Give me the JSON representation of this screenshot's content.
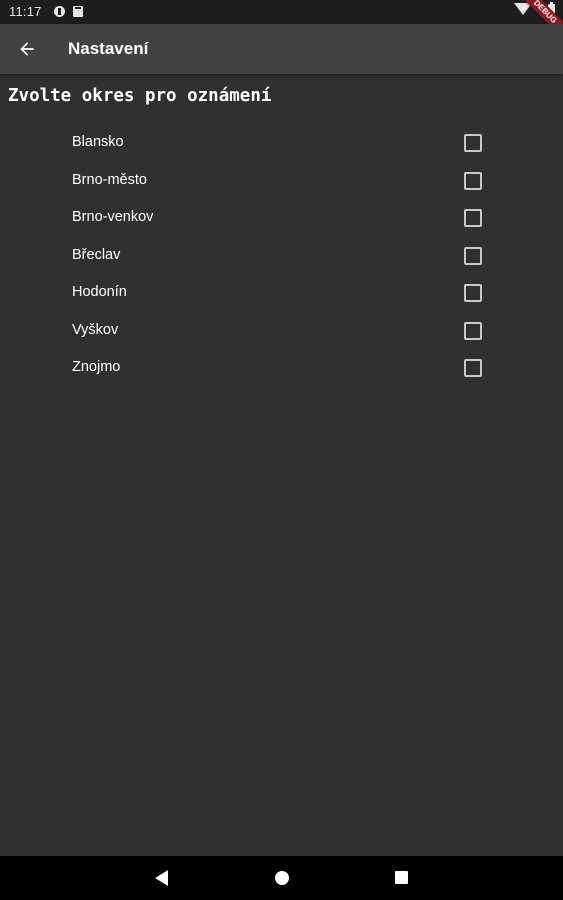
{
  "status_bar": {
    "time": "11:17",
    "icons": [
      "notification-icon",
      "sim-card-icon",
      "wifi-icon",
      "battery-icon"
    ]
  },
  "debug_banner": "DEBUG",
  "app_bar": {
    "title": "Nastavení",
    "back_icon": "arrow-back-icon"
  },
  "heading": "Zvolte okres pro oznámení",
  "districts": [
    {
      "label": "Blansko",
      "checked": false
    },
    {
      "label": "Brno-město",
      "checked": false
    },
    {
      "label": "Brno-venkov",
      "checked": false
    },
    {
      "label": "Břeclav",
      "checked": false
    },
    {
      "label": "Hodonín",
      "checked": false
    },
    {
      "label": "Vyškov",
      "checked": false
    },
    {
      "label": "Znojmo",
      "checked": false
    }
  ],
  "colors": {
    "background": "#303030",
    "app_bar": "#424242",
    "status_bar": "#1e1e1e",
    "nav_bar": "#000000",
    "text": "#ffffff"
  }
}
